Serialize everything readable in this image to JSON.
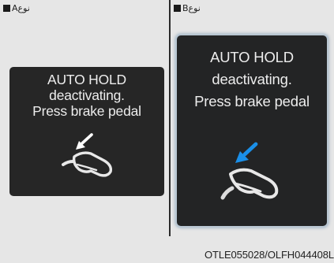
{
  "panels": [
    {
      "type_label": "نوعA",
      "message": [
        "AUTO HOLD",
        "deactivating.",
        "Press brake pedal"
      ],
      "icon": "foot-on-brake-pedal-icon",
      "arrow_color": "#ffffff"
    },
    {
      "type_label": "نوعB",
      "message": [
        "AUTO HOLD",
        "deactivating.",
        "Press brake pedal"
      ],
      "icon": "foot-on-brake-pedal-icon",
      "arrow_color": "#1a8fe8"
    }
  ],
  "caption": "OTLE055028/OLFH044408L"
}
